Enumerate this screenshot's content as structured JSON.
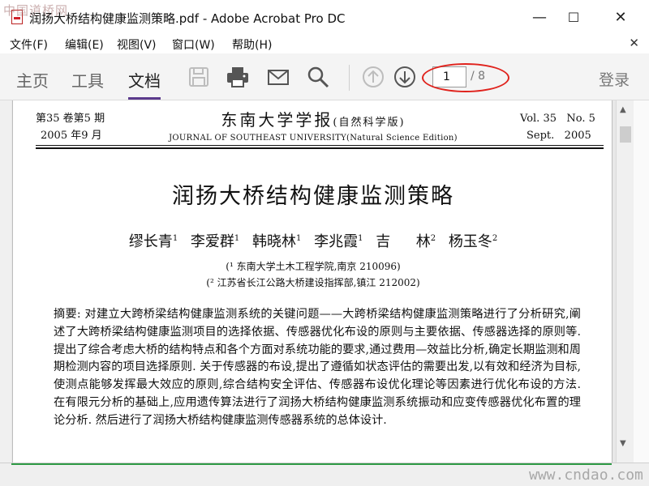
{
  "window": {
    "title": "润扬大桥结构健康监测策略.pdf - Adobe Acrobat Pro DC",
    "watermark_top": "中国道桥网",
    "minimize": "—",
    "maximize": "☐",
    "close": "✕"
  },
  "menu": {
    "items": [
      "文件(F)",
      "编辑(E)",
      "视图(V)",
      "窗口(W)",
      "帮助(H)"
    ],
    "close_doc": "✕"
  },
  "toolbar": {
    "tabs": [
      "主页",
      "工具",
      "文档"
    ],
    "active_tab": "文档",
    "icons": [
      "save-icon",
      "print-icon",
      "email-icon",
      "search-icon",
      "prev-page-icon",
      "next-page-icon"
    ],
    "page_current": "1",
    "page_total": "/ 8",
    "login": "登录",
    "highlight_color": "#e0231d"
  },
  "document": {
    "header_left": [
      "第35 卷第5 期",
      "2005 年9 月"
    ],
    "journal_cn": "东南大学学报",
    "journal_cn_sub": "(自然科学版)",
    "journal_en": "JOURNAL OF SOUTHEAST UNIVERSITY(Natural Science Edition)",
    "header_right": [
      "Vol. 35   No. 5",
      "Sept.   2005"
    ],
    "title": "润扬大桥结构健康监测策略",
    "authors": [
      {
        "name": "缪长青",
        "sup": "1"
      },
      {
        "name": "李爱群",
        "sup": "1"
      },
      {
        "name": "韩晓林",
        "sup": "1"
      },
      {
        "name": "李兆霞",
        "sup": "1"
      },
      {
        "name": "吉  林",
        "sup": "2"
      },
      {
        "name": "杨玉冬",
        "sup": "2"
      }
    ],
    "affiliations": [
      "(¹ 东南大学土木工程学院,南京 210096)",
      "(² 江苏省长江公路大桥建设指挥部,镇江 212002)"
    ],
    "abstract": "摘要: 对建立大跨桥梁结构健康监测系统的关键问题——大跨桥梁结构健康监测策略进行了分析研究,阐述了大跨桥梁结构健康监测项目的选择依据、传感器优化布设的原则与主要依据、传感器选择的原则等. 提出了综合考虑大桥的结构特点和各个方面对系统功能的要求,通过费用—效益比分析,确定长期监测和周期检测内容的项目选择原则. 关于传感器的布设,提出了遵循如状态评估的需要出发,以有效和经济为目标,使测点能够发挥最大效应的原则,综合结构安全评估、传感器布设优化理论等因素进行优化布设的方法. 在有限元分析的基础上,应用遗传算法进行了润扬大桥结构健康监测系统振动和应变传感器优化布置的理论分析. 然后进行了润扬大桥结构健康监测传感器系统的总体设计."
  },
  "watermark_bottom": "www.cndao.com"
}
